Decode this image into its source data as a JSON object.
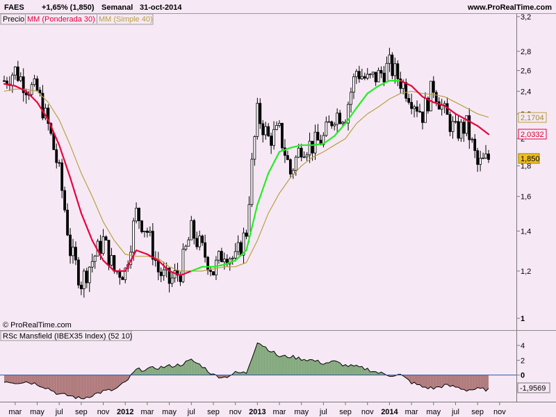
{
  "header": {
    "ticker": "FAES",
    "change": "+1,65% (1,850)",
    "period": "Semanal",
    "date": "31-oct-2014",
    "site": "www.ProRealTime.com"
  },
  "legend": {
    "price": "Precio",
    "ma_weighted": "MM (Ponderada 30)",
    "ma_simple": "MM (Simple 40)"
  },
  "copyright": "© ProRealTime.com",
  "indicator_title": "RSc Mansfield (IBEX35 Index) (52 10)",
  "colors": {
    "background": "#f6e9f5",
    "ma_weighted": "#e8003c",
    "ma_simple": "#b8a040",
    "ma_up": "#22ee22",
    "indicator_line": "#4060a0",
    "indicator_positive_fill": "#6a9a62",
    "indicator_negative_fill": "#a06060"
  },
  "chart_data": [
    {
      "type": "candlestick",
      "title": "FAES",
      "scale": "log",
      "ylim": [
        1.0,
        3.2
      ],
      "y_ticks": [
        "3,2",
        "2,8",
        "2,6",
        "2,4",
        "2,2",
        "2",
        "1,8",
        "1,6",
        "1,4",
        "1,2",
        "1"
      ],
      "x_ticks": [
        "mar",
        "may",
        "jul",
        "sep",
        "nov",
        "2012",
        "mar",
        "may",
        "jul",
        "sep",
        "nov",
        "2013",
        "mar",
        "may",
        "jul",
        "sep",
        "nov",
        "2014",
        "mar",
        "may",
        "jul",
        "sep",
        "nov"
      ],
      "x": [
        "2011-02",
        "2011-03",
        "2011-04",
        "2011-05",
        "2011-06",
        "2011-07",
        "2011-08",
        "2011-09",
        "2011-10",
        "2011-11",
        "2011-12",
        "2012-01",
        "2012-02",
        "2012-03",
        "2012-04",
        "2012-05",
        "2012-06",
        "2012-07",
        "2012-08",
        "2012-09",
        "2012-10",
        "2012-11",
        "2012-12",
        "2013-01",
        "2013-02",
        "2013-03",
        "2013-04",
        "2013-05",
        "2013-06",
        "2013-07",
        "2013-08",
        "2013-09",
        "2013-10",
        "2013-11",
        "2013-12",
        "2014-01",
        "2014-02",
        "2014-03",
        "2014-04",
        "2014-05",
        "2014-06",
        "2014-07",
        "2014-08",
        "2014-09",
        "2014-10"
      ],
      "series": [
        {
          "name": "Precio",
          "values": [
            2.5,
            2.6,
            2.45,
            2.4,
            2.1,
            1.75,
            1.3,
            1.15,
            1.25,
            1.35,
            1.2,
            1.2,
            1.5,
            1.4,
            1.2,
            1.15,
            1.2,
            1.4,
            1.3,
            1.2,
            1.3,
            1.25,
            1.4,
            2.2,
            2.0,
            2.05,
            1.75,
            1.95,
            1.95,
            2.0,
            2.2,
            2.2,
            2.6,
            2.5,
            2.55,
            2.65,
            2.5,
            2.35,
            2.2,
            2.45,
            2.2,
            2.05,
            2.1,
            1.8,
            1.85
          ]
        },
        {
          "name": "MM (Ponderada 30)",
          "values": [
            2.47,
            2.45,
            2.4,
            2.3,
            2.15,
            1.95,
            1.72,
            1.5,
            1.35,
            1.25,
            1.2,
            1.2,
            1.3,
            1.28,
            1.25,
            1.2,
            1.18,
            1.2,
            1.22,
            1.22,
            1.23,
            1.25,
            1.3,
            1.55,
            1.75,
            1.9,
            1.93,
            1.95,
            1.95,
            1.96,
            2.02,
            2.12,
            2.25,
            2.38,
            2.45,
            2.5,
            2.5,
            2.45,
            2.35,
            2.3,
            2.27,
            2.2,
            2.15,
            2.1,
            2.0332
          ]
        },
        {
          "name": "MM (Simple 40)",
          "values": [
            2.4,
            2.42,
            2.42,
            2.4,
            2.3,
            2.15,
            1.95,
            1.75,
            1.6,
            1.45,
            1.35,
            1.28,
            1.27,
            1.27,
            1.26,
            1.22,
            1.2,
            1.2,
            1.2,
            1.21,
            1.22,
            1.22,
            1.24,
            1.35,
            1.5,
            1.62,
            1.72,
            1.8,
            1.86,
            1.9,
            1.95,
            2.0,
            2.12,
            2.2,
            2.26,
            2.33,
            2.38,
            2.4,
            2.38,
            2.37,
            2.35,
            2.3,
            2.25,
            2.2,
            2.1704
          ]
        }
      ],
      "labels": [
        "2,1704",
        "2,0332",
        "1,850"
      ]
    },
    {
      "type": "area",
      "title": "RSc Mansfield (IBEX35 Index) (52 10)",
      "ylim": [
        -3.5,
        5.5
      ],
      "y_ticks": [
        "4",
        "2",
        "0",
        "-1,9569"
      ],
      "x": [
        "2011-02",
        "2011-03",
        "2011-04",
        "2011-05",
        "2011-06",
        "2011-07",
        "2011-08",
        "2011-09",
        "2011-10",
        "2011-11",
        "2011-12",
        "2012-01",
        "2012-02",
        "2012-03",
        "2012-04",
        "2012-05",
        "2012-06",
        "2012-07",
        "2012-08",
        "2012-09",
        "2012-10",
        "2012-11",
        "2012-12",
        "2013-01",
        "2013-02",
        "2013-03",
        "2013-04",
        "2013-05",
        "2013-06",
        "2013-07",
        "2013-08",
        "2013-09",
        "2013-10",
        "2013-11",
        "2013-12",
        "2014-01",
        "2014-02",
        "2014-03",
        "2014-04",
        "2014-05",
        "2014-06",
        "2014-07",
        "2014-08",
        "2014-09",
        "2014-10"
      ],
      "values": [
        -0.8,
        -1.0,
        -0.9,
        -1.2,
        -1.8,
        -2.6,
        -2.8,
        -3.2,
        -2.7,
        -2.2,
        -2.0,
        -1.0,
        0.7,
        0.8,
        1.0,
        1.2,
        1.4,
        2.0,
        1.2,
        0.0,
        -0.3,
        0.3,
        0.3,
        4.5,
        3.5,
        2.5,
        2.5,
        2.2,
        2.0,
        1.6,
        1.8,
        1.3,
        1.1,
        0.8,
        0.3,
        0.0,
        0.0,
        -1.0,
        -1.6,
        -1.8,
        -1.4,
        -1.6,
        -2.0,
        -1.9,
        -1.9569
      ]
    }
  ]
}
